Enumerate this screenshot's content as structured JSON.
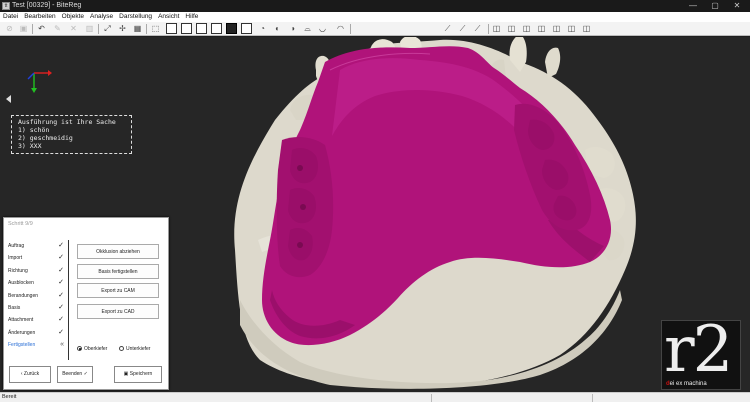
{
  "window": {
    "title": "Test [00329] - BiteReg",
    "app_icon_letters": "tt",
    "minimize": "—",
    "maximize": "▢",
    "close": "✕"
  },
  "menu": [
    "Datei",
    "Bearbeiten",
    "Objekte",
    "Analyse",
    "Darstellung",
    "Ansicht",
    "Hilfe"
  ],
  "annotation": {
    "lines": [
      "Ausführung ist Ihre Sache",
      "1) schön",
      "2) geschmeidig",
      "3) XXX"
    ]
  },
  "logo": {
    "mark": "r2",
    "tag_prefix": "d",
    "tag_rest": "ei ex machina"
  },
  "wizard": {
    "title": "Schritt 9/9",
    "steps": [
      {
        "label": "Auftrag",
        "state": "done"
      },
      {
        "label": "Import",
        "state": "done"
      },
      {
        "label": "Richtung",
        "state": "done"
      },
      {
        "label": "Ausblocken",
        "state": "done"
      },
      {
        "label": "Berandungen",
        "state": "done"
      },
      {
        "label": "Basis",
        "state": "done"
      },
      {
        "label": "Attachment",
        "state": "done"
      },
      {
        "label": "Änderungen",
        "state": "done"
      },
      {
        "label": "Fertigstellen",
        "state": "active"
      }
    ],
    "actions": [
      "Okklusion abziehen",
      "Basis fertigstellen",
      "Export zu CAM",
      "Export zu CAD"
    ],
    "jaw_options": [
      {
        "label": "Oberkiefer",
        "selected": true
      },
      {
        "label": "Unterkiefer",
        "selected": false
      }
    ],
    "back_label": "Zurück",
    "finish_label": "Beenden",
    "save_label": "Speichern"
  },
  "status": {
    "text": "Bereit"
  },
  "colors": {
    "base_model": "#ddd9cc",
    "prosthesis": "#b0137a",
    "viewport": "#262626"
  }
}
